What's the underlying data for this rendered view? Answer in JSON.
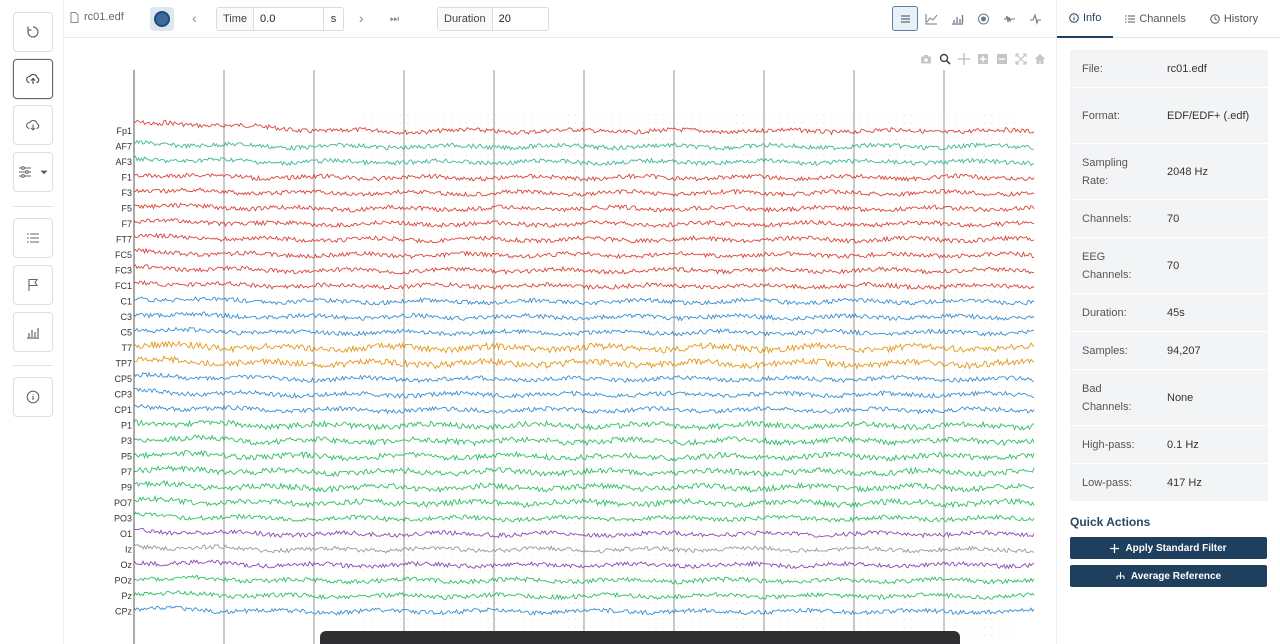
{
  "toolbar": {
    "file_name": "rc01.edf",
    "time_label": "Time",
    "time_value": "0.0",
    "time_unit": "s",
    "duration_label": "Duration",
    "duration_value": "20",
    "view_icons": [
      "list-icon",
      "line-chart-icon",
      "bar-chart-icon",
      "topomap-icon",
      "waveform-icon",
      "spike-icon"
    ],
    "active_view": "list-icon"
  },
  "rail": {
    "icons": [
      "reset-icon",
      "upload-icon",
      "download-icon",
      "filter-settings-icon",
      "list-icon",
      "flag-icon",
      "bar-chart-icon",
      "info-icon"
    ]
  },
  "tabs": [
    {
      "label": "Info",
      "icon": "info-icon",
      "active": true
    },
    {
      "label": "Channels",
      "icon": "list-icon",
      "active": false
    },
    {
      "label": "History",
      "icon": "history-icon",
      "active": false
    }
  ],
  "info": [
    {
      "key": "File:",
      "value": "rc01.edf"
    },
    {
      "key": "Format:",
      "value": "EDF/EDF+ (.edf)"
    },
    {
      "key": "Sampling Rate:",
      "value": "2048 Hz"
    },
    {
      "key": "Channels:",
      "value": "70"
    },
    {
      "key": "EEG Channels:",
      "value": "70"
    },
    {
      "key": "Duration:",
      "value": "45s"
    },
    {
      "key": "Samples:",
      "value": "94,207"
    },
    {
      "key": "Bad Channels:",
      "value": "None"
    },
    {
      "key": "High-pass:",
      "value": "0.1 Hz"
    },
    {
      "key": "Low-pass:",
      "value": "417 Hz"
    }
  ],
  "quick_actions": {
    "title": "Quick Actions",
    "buttons": [
      {
        "label": "Apply Standard Filter",
        "icon": "filter-icon"
      },
      {
        "label": "Average Reference",
        "icon": "reference-icon"
      }
    ]
  },
  "chart_data": {
    "type": "line",
    "channels": [
      "Fp1",
      "AF7",
      "AF3",
      "F1",
      "F3",
      "F5",
      "F7",
      "FT7",
      "FC5",
      "FC3",
      "FC1",
      "C1",
      "C3",
      "C5",
      "T7",
      "TP7",
      "CP5",
      "CP3",
      "CP1",
      "P1",
      "P3",
      "P5",
      "P7",
      "P9",
      "PO7",
      "PO3",
      "O1",
      "Iz",
      "Oz",
      "POz",
      "Pz",
      "CPz"
    ],
    "channel_colors": [
      "#d9453c",
      "#3fb89a",
      "#3fb89a",
      "#d9453c",
      "#d9453c",
      "#d9453c",
      "#d9453c",
      "#d9453c",
      "#d9453c",
      "#d9453c",
      "#d9453c",
      "#3b8fd0",
      "#3b8fd0",
      "#3b8fd0",
      "#e39a1e",
      "#e39a1e",
      "#3b8fd0",
      "#3b8fd0",
      "#3b8fd0",
      "#2fbf66",
      "#2fbf66",
      "#2fbf66",
      "#2fbf66",
      "#2fbf66",
      "#2fbf66",
      "#2fbf66",
      "#8b4ab2",
      "#9a9a9a",
      "#8b4ab2",
      "#2fbf66",
      "#2fbf66",
      "#3b8fd0"
    ],
    "x_range_s": [
      0,
      20
    ],
    "grid": true
  },
  "bottom_bar": {}
}
